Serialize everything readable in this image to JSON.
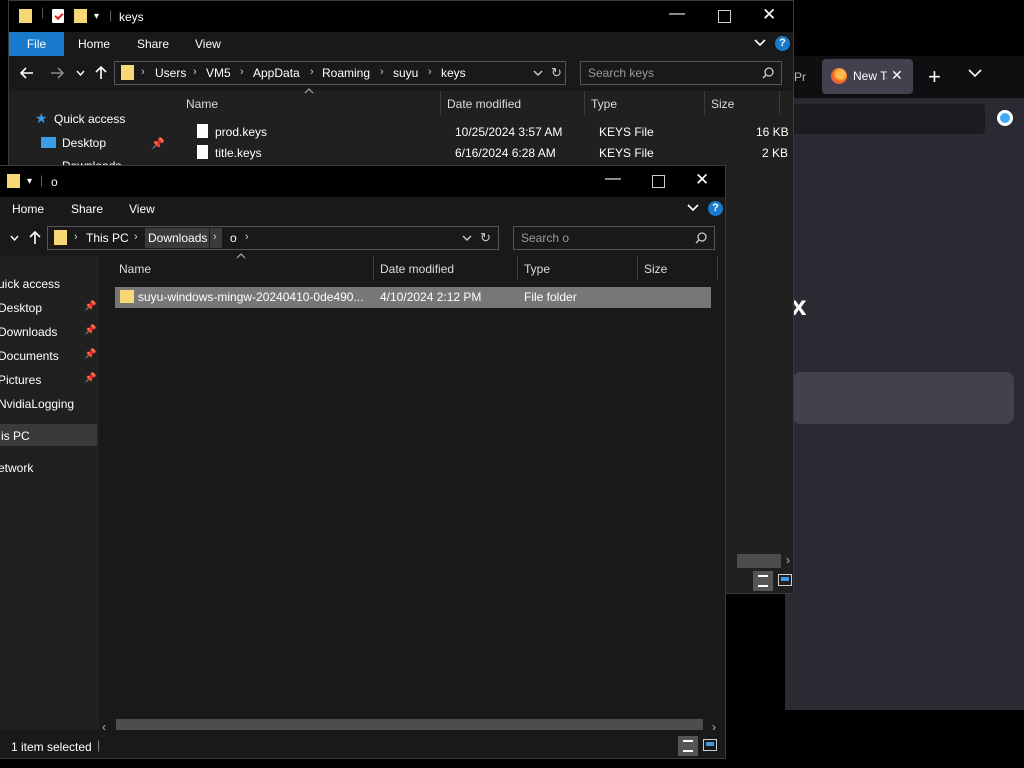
{
  "browser": {
    "tab_partial_label": "Pr",
    "tab_label": "New Tab",
    "tab_visible_label": "New Ta"
  },
  "win_back": {
    "title": "keys",
    "ribbon": {
      "file": "File",
      "home": "Home",
      "share": "Share",
      "view": "View"
    },
    "breadcrumb": [
      "Users",
      "VM5",
      "AppData",
      "Roaming",
      "suyu",
      "keys"
    ],
    "search_placeholder": "Search keys",
    "columns": {
      "name": "Name",
      "date": "Date modified",
      "type": "Type",
      "size": "Size"
    },
    "nav": {
      "quick_access": "Quick access",
      "desktop": "Desktop",
      "downloads": "Downloads"
    },
    "files": [
      {
        "name": "prod.keys",
        "date": "10/25/2024 3:57 AM",
        "type": "KEYS File",
        "size": "16 KB"
      },
      {
        "name": "title.keys",
        "date": "6/16/2024 6:28 AM",
        "type": "KEYS File",
        "size": "2 KB"
      }
    ]
  },
  "win_front": {
    "title": "o",
    "ribbon": {
      "home": "Home",
      "share": "Share",
      "view": "View"
    },
    "breadcrumb": [
      "This PC",
      "Downloads",
      "o"
    ],
    "search_placeholder": "Search o",
    "columns": {
      "name": "Name",
      "date": "Date modified",
      "type": "Type",
      "size": "Size"
    },
    "nav": {
      "quick_access": "uick access",
      "desktop": "Desktop",
      "downloads": "Downloads",
      "documents": "Documents",
      "pictures": "Pictures",
      "nvidia": "NvidiaLogging",
      "this_pc": "is PC",
      "network": "etwork"
    },
    "files": [
      {
        "name": "suyu-windows-mingw-20240410-0de490...",
        "date": "4/10/2024 2:12 PM",
        "type": "File folder",
        "size": ""
      }
    ],
    "status": "1 item selected"
  },
  "colors": {
    "accent": "#1979ca",
    "selection": "#777777",
    "folder": "#f8d775"
  }
}
